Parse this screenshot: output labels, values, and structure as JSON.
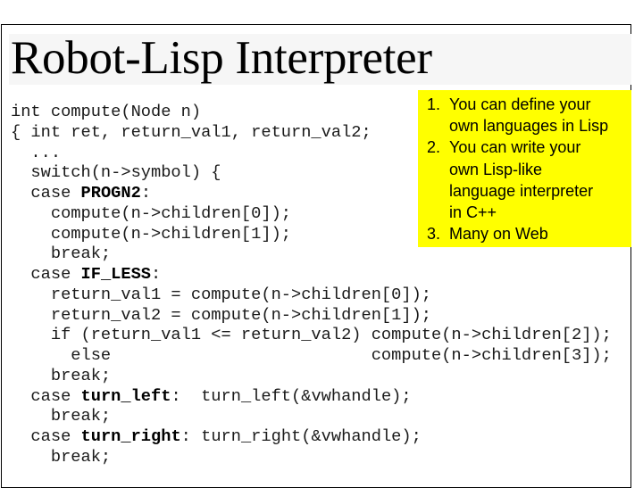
{
  "slide": {
    "title": "Robot-Lisp Interpreter",
    "colors": {
      "callout_background": "#ffff00",
      "title_band": "#f6f6f6",
      "frame_border": "#000000"
    }
  },
  "code": {
    "language": "C++",
    "lines": [
      {
        "pre": "int compute(Node n)",
        "bold": "",
        "post": ""
      },
      {
        "pre": "{ int ret, return_val1, return_val2;",
        "bold": "",
        "post": ""
      },
      {
        "pre": "  ...",
        "bold": "",
        "post": ""
      },
      {
        "pre": "  switch(n->symbol) {",
        "bold": "",
        "post": ""
      },
      {
        "pre": "  case ",
        "bold": "PROGN2",
        "post": ":"
      },
      {
        "pre": "    compute(n->children[0]);",
        "bold": "",
        "post": ""
      },
      {
        "pre": "    compute(n->children[1]);",
        "bold": "",
        "post": ""
      },
      {
        "pre": "    break;",
        "bold": "",
        "post": ""
      },
      {
        "pre": "  case ",
        "bold": "IF_LESS",
        "post": ":"
      },
      {
        "pre": "    return_val1 = compute(n->children[0]);",
        "bold": "",
        "post": ""
      },
      {
        "pre": "    return_val2 = compute(n->children[1]);",
        "bold": "",
        "post": ""
      },
      {
        "pre": "    if (return_val1 <= return_val2) compute(n->children[2]);",
        "bold": "",
        "post": ""
      },
      {
        "pre": "      else                          compute(n->children[3]);",
        "bold": "",
        "post": ""
      },
      {
        "pre": "    break;",
        "bold": "",
        "post": ""
      },
      {
        "pre": "  case ",
        "bold": "turn_left",
        "post": ":  turn_left(&vwhandle);"
      },
      {
        "pre": "    break;",
        "bold": "",
        "post": ""
      },
      {
        "pre": "  case ",
        "bold": "turn_right",
        "post": ": turn_right(&vwhandle);"
      },
      {
        "pre": "    break;",
        "bold": "",
        "post": ""
      }
    ]
  },
  "callout": {
    "items": [
      {
        "number": "1.",
        "lines": [
          "You can define your",
          "own languages in Lisp"
        ]
      },
      {
        "number": "2.",
        "lines": [
          "You can write your",
          "own Lisp-like",
          "language interpreter",
          "in C++"
        ]
      },
      {
        "number": "3.",
        "lines": [
          "Many on Web"
        ]
      }
    ]
  }
}
